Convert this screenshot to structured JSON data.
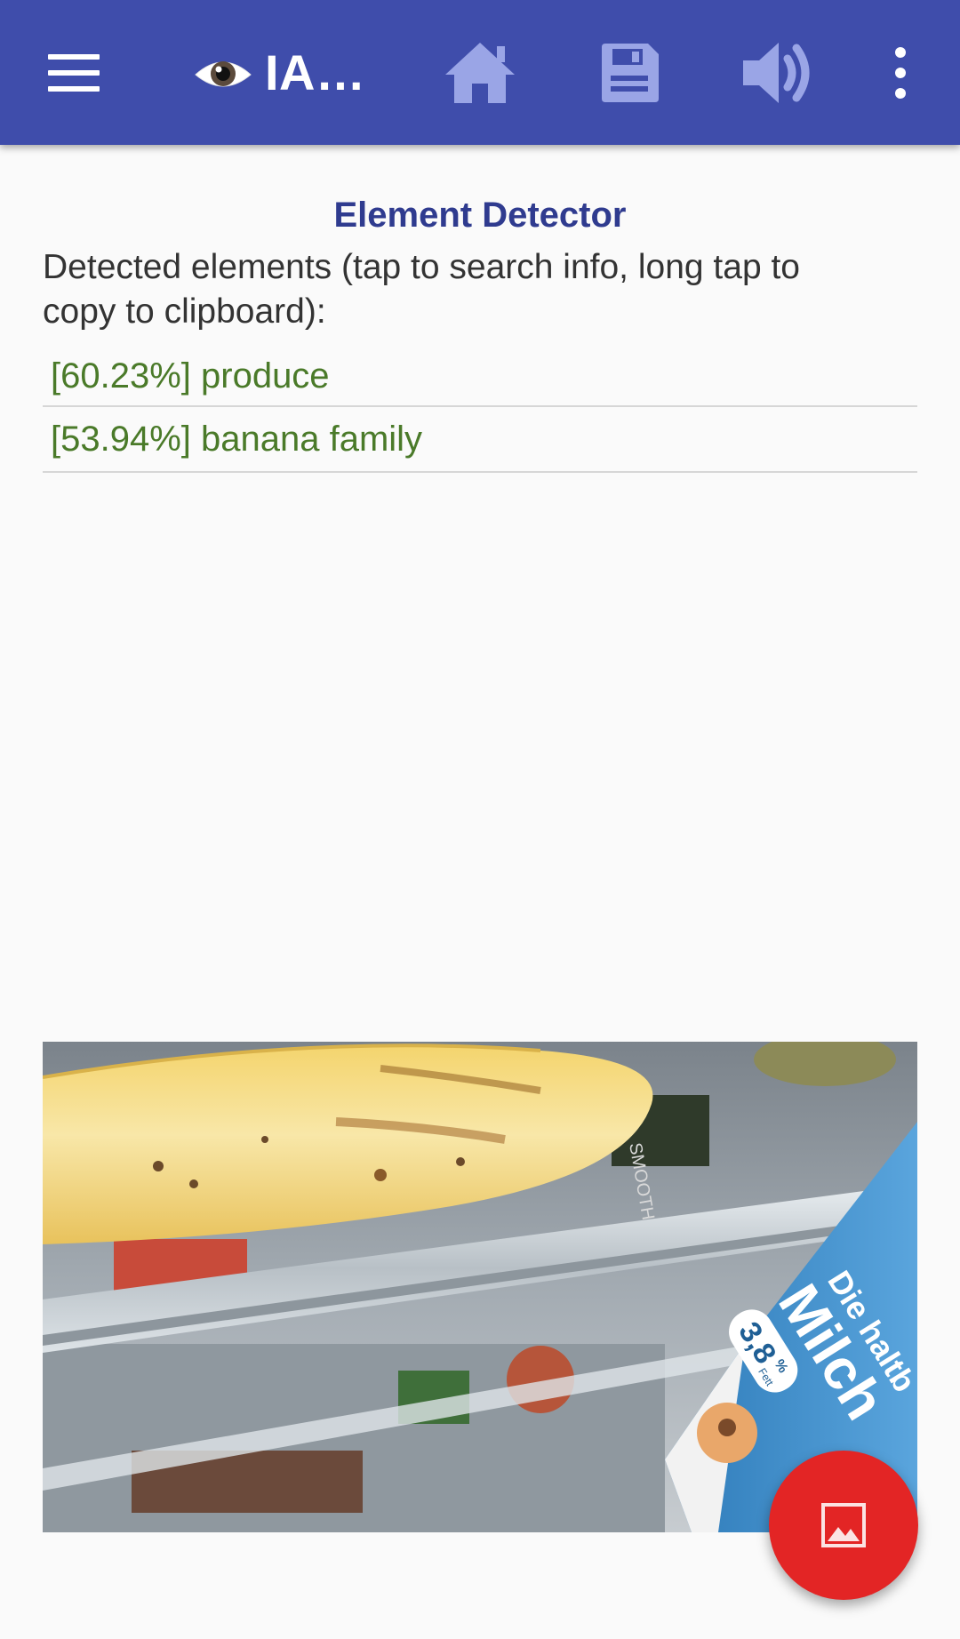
{
  "toolbar": {
    "menu_icon": "menu-icon",
    "app_icon": "eye-icon",
    "title": "IA…",
    "actions": [
      {
        "icon": "home-icon"
      },
      {
        "icon": "save-icon"
      },
      {
        "icon": "volume-icon"
      },
      {
        "icon": "more-vert-icon"
      }
    ],
    "background_color": "#3f4dab",
    "action_icon_color": "#9aa5e6"
  },
  "main": {
    "section_title": "Element Detector",
    "instructions": "Detected elements (tap to search info, long tap to copy to clipboard):",
    "results": [
      {
        "label": "[60.23%] produce"
      },
      {
        "label": "[53.94%] banana family"
      }
    ],
    "result_color": "#4a7a29",
    "title_color": "#2f3b8f"
  },
  "photo": {
    "subject": "banana in refrigerator with milk carton",
    "carton_text_1": "Die haltb",
    "carton_text_2": "Milch",
    "carton_text_3": "3,8",
    "carton_text_4": "%",
    "carton_text_5": "Fett",
    "bottle_text": "SMOOTHIE"
  },
  "fab": {
    "icon": "image-icon",
    "color": "#e32525"
  }
}
